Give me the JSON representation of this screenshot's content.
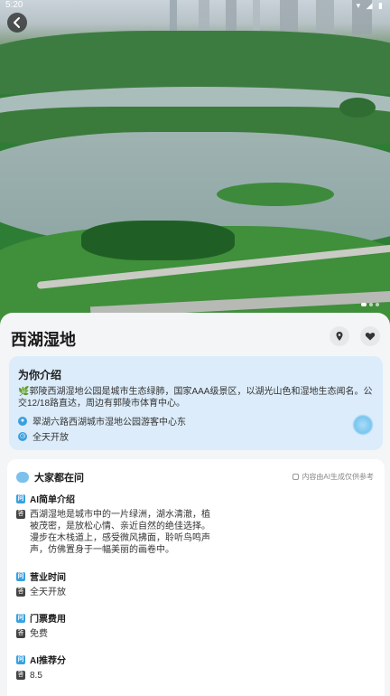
{
  "status_bar": {
    "time": "5:20",
    "icons": "▾ ◢ ▮"
  },
  "header": {
    "back_icon": "chevron-left-icon"
  },
  "place": {
    "name": "西湖湿地"
  },
  "intro": {
    "title": "为你介绍",
    "text": "🌿郭陵西湖湿地公园是城市生态绿肺，国家AAA级景区，以湖光山色和湿地生态闻名。公交12/18路直达，周边有郭陵市体育中心。",
    "address": "翠湖六路西湖城市湿地公园游客中心东",
    "hours": "全天开放"
  },
  "ask": {
    "title": "大家都在问",
    "ai_note": "内容由AI生成仅供参考",
    "items": [
      {
        "q": "AI简单介绍",
        "a": "西湖湿地是城市中的一片绿洲，湖水清澈，植被茂密，是放松心情、亲近自然的绝佳选择。漫步在木栈道上，感受微风拂面，聆听鸟鸣声声，仿佛置身于一幅美丽的画卷中。"
      },
      {
        "q": "营业时间",
        "a": "全天开放"
      },
      {
        "q": "门票费用",
        "a": "免费"
      },
      {
        "q": "AI推荐分",
        "a": "8.5"
      }
    ]
  },
  "colors": {
    "accent": "#3aa0e0",
    "intro_bg": "#dcecfa"
  }
}
